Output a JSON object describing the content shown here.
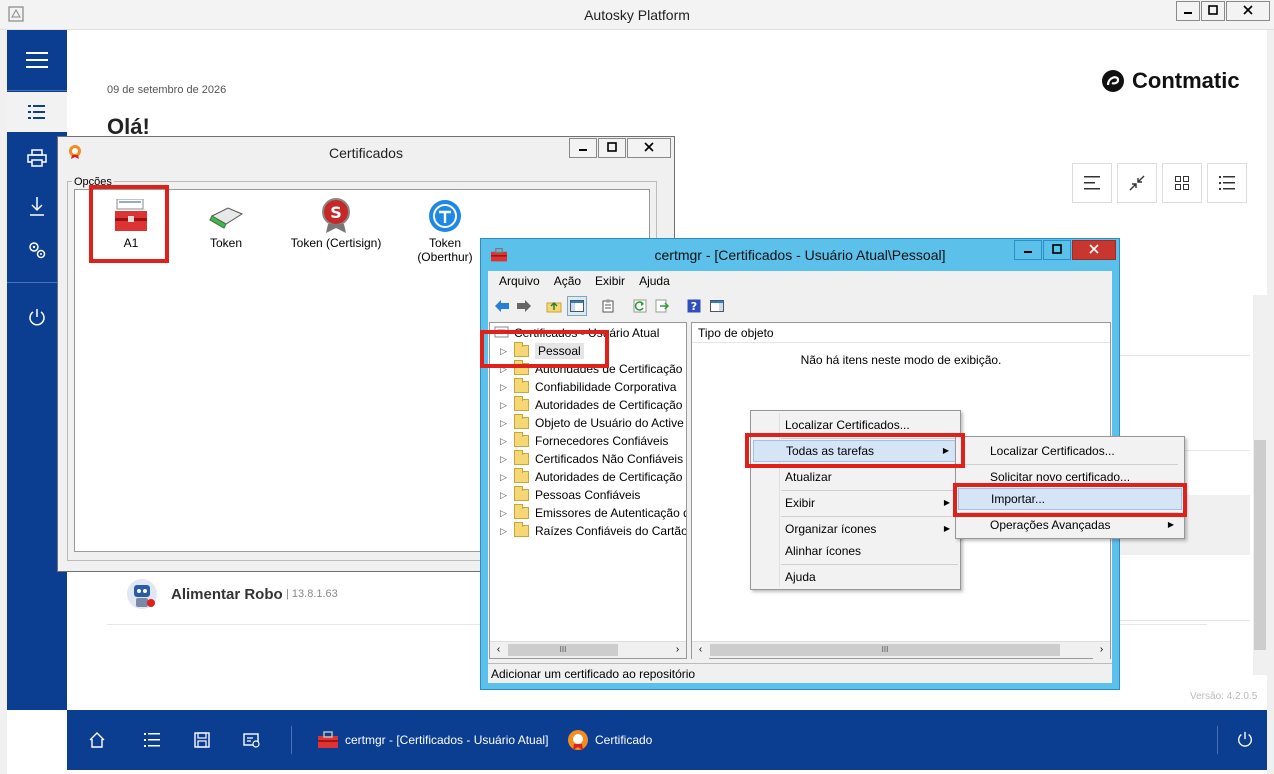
{
  "outer_window": {
    "title": "Autosky Platform",
    "minimize": "—",
    "maximize": "□",
    "close": "✕"
  },
  "sidebar": {
    "items": [
      "menu-icon",
      "list-icon",
      "printer-icon",
      "download-icon",
      "settings-icon",
      "power-icon"
    ]
  },
  "main": {
    "date": "09 de setembro de 2026",
    "greeting": "Olá!",
    "logo_text": "Contmatic",
    "robot": {
      "name": "Alimentar Robo",
      "version": "13.8.1.63"
    },
    "version_label": "Versão: 4.2.0.5"
  },
  "taskbar": {
    "certmgr_label": "certmgr - [Certificados - Usuário Atual]",
    "certificado_label": "Certificado"
  },
  "certificados_window": {
    "title": "Certificados",
    "group_label": "Opções",
    "options": [
      {
        "label": "A1"
      },
      {
        "label": "Token"
      },
      {
        "label": "Token (Certisign)"
      },
      {
        "label": "Token\n(Oberthur)"
      }
    ]
  },
  "certmgr_window": {
    "title": "certmgr - [Certificados - Usuário Atual\\Pessoal]",
    "menu": [
      "Arquivo",
      "Ação",
      "Exibir",
      "Ajuda"
    ],
    "tree_root": "Certificados - Usuário Atual",
    "tree_items": [
      "Pessoal",
      "Autoridades de Certificação Raiz Confiáveis",
      "Confiabilidade Corporativa",
      "Autoridades de Certificação Intermediárias",
      "Objeto de Usuário do Active Directory",
      "Fornecedores Confiáveis",
      "Certificados Não Confiáveis",
      "Autoridades de Certificação Raiz de Terceiros",
      "Pessoas Confiáveis",
      "Emissores de Autenticação de Cliente",
      "Raízes Confiáveis do Cartão Inteligente"
    ],
    "column_header": "Tipo de objeto",
    "empty_message": "Não há itens neste modo de exibição.",
    "status": "Adicionar um certificado ao repositório",
    "scroll_thumb": "III"
  },
  "context_menu": {
    "items": [
      "Localizar Certificados...",
      "Todas as tarefas",
      "Atualizar",
      "Exibir",
      "Organizar ícones",
      "Alinhar ícones",
      "Ajuda"
    ]
  },
  "submenu": {
    "items": [
      "Localizar Certificados...",
      "Solicitar novo certificado...",
      "Importar...",
      "Operações Avançadas"
    ]
  },
  "colors": {
    "sidebar_blue": "#0b3d91",
    "highlight_red": "#e0201b",
    "menu_highlight": "#d5e5f6",
    "certmgr_frame": "#5bc0ea"
  }
}
